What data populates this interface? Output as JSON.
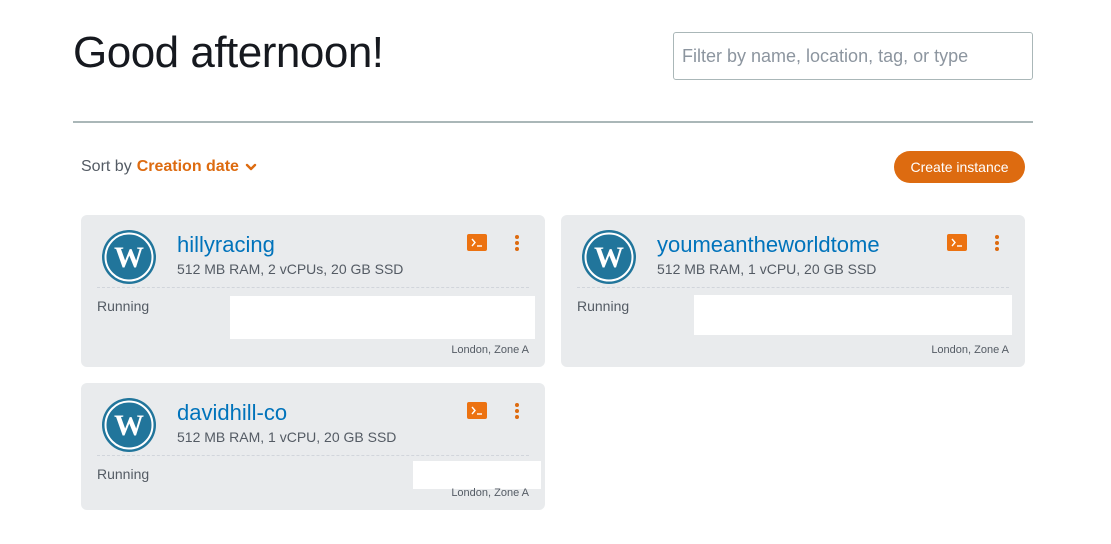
{
  "header": {
    "greeting": "Good afternoon!",
    "filter_placeholder": "Filter by name, location, tag, or type"
  },
  "toolbar": {
    "sort_label": "Sort by",
    "sort_value": "Creation date",
    "create_label": "Create instance"
  },
  "colors": {
    "accent": "#dd6b10",
    "link": "#0073bb",
    "card_bg": "#e9ebed",
    "wordpress": "#21759b"
  },
  "instances": [
    {
      "name": "hillyracing",
      "specs": "512 MB RAM, 2 vCPUs, 20 GB SSD",
      "status": "Running",
      "location": "London, Zone A",
      "icon": "wordpress-logo"
    },
    {
      "name": "youmeantheworldtome",
      "specs": "512 MB RAM, 1 vCPU, 20 GB SSD",
      "status": "Running",
      "location": "London, Zone A",
      "icon": "wordpress-logo"
    },
    {
      "name": "davidhill-co",
      "specs": "512 MB RAM, 1 vCPU, 20 GB SSD",
      "status": "Running",
      "location": "London, Zone A",
      "icon": "wordpress-logo"
    }
  ]
}
